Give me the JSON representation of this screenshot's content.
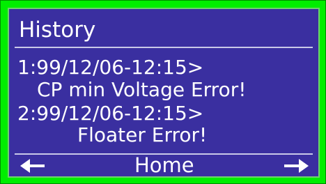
{
  "screen": {
    "title": "History",
    "entries": [
      {
        "header": "1:99/12/06-12:15>",
        "message": "CP min Voltage Error!"
      },
      {
        "header": "2:99/12/06-12:15>",
        "message": "Floater Error!"
      }
    ],
    "nav": {
      "left_icon": "left-arrow-icon",
      "home_label": "Home",
      "right_icon": "right-arrow-icon"
    }
  },
  "colors": {
    "frame": "#00ee00",
    "screen_background": "#3a2fa0",
    "text": "#ffffff"
  }
}
